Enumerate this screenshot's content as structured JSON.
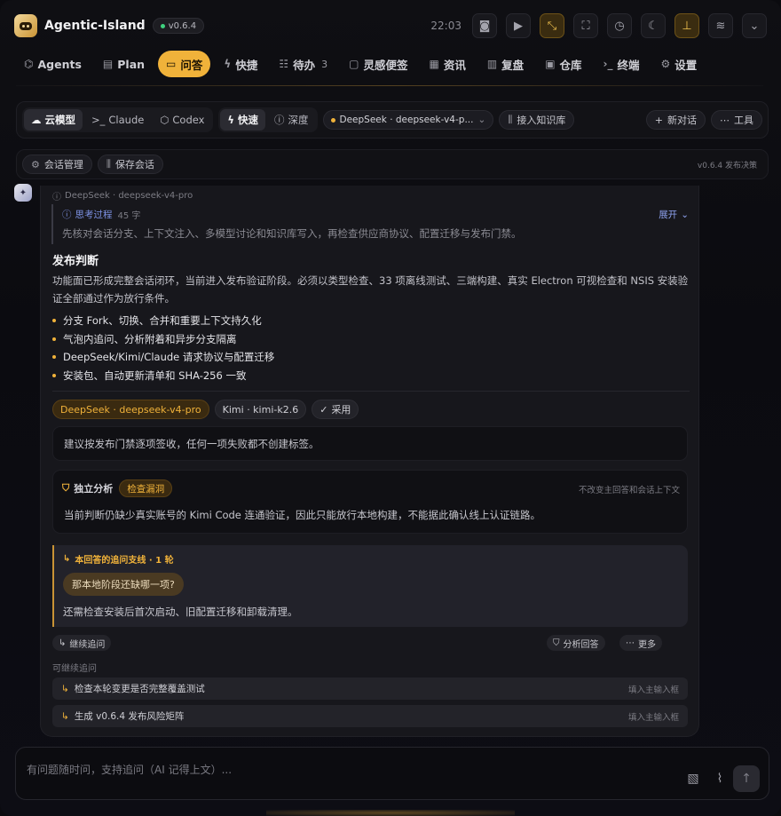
{
  "app": {
    "title": "Agentic-Island",
    "version": "v0.6.4",
    "clock": "22:03"
  },
  "nav": [
    {
      "id": "agents",
      "label": "Agents",
      "icon": "⌬"
    },
    {
      "id": "plan",
      "label": "Plan",
      "icon": "▤"
    },
    {
      "id": "qa",
      "label": "问答",
      "icon": "▭",
      "active": true
    },
    {
      "id": "quick",
      "label": "快捷",
      "icon": "ϟ"
    },
    {
      "id": "todo",
      "label": "待办",
      "icon": "☷",
      "badge": "3"
    },
    {
      "id": "notes",
      "label": "灵感便签",
      "icon": "▢"
    },
    {
      "id": "news",
      "label": "资讯",
      "icon": "▦"
    },
    {
      "id": "review",
      "label": "复盘",
      "icon": "▥"
    },
    {
      "id": "repo",
      "label": "仓库",
      "icon": "▣"
    },
    {
      "id": "terminal",
      "label": "终端",
      "icon": "›_"
    },
    {
      "id": "settings",
      "label": "设置",
      "icon": "⚙"
    }
  ],
  "toolbar": {
    "providers": [
      {
        "label": "云模型",
        "icon": "☁",
        "on": true
      },
      {
        "label": "Claude",
        "icon": ">_"
      },
      {
        "label": "Codex",
        "icon": "⬡"
      }
    ],
    "modes": [
      {
        "label": "快速",
        "icon": "ϟ",
        "on": true
      },
      {
        "label": "深度",
        "icon": "ⓘ"
      }
    ],
    "model": "DeepSeek · deepseek-v4-p...",
    "knowledge": "接入知识库",
    "new_chat": "新对话",
    "tools": "工具"
  },
  "session": {
    "manage": "会话管理",
    "save": "保存会话",
    "note": "v0.6.4 发布决策"
  },
  "message": {
    "source": "DeepSeek · deepseek-v4-pro",
    "think_title": "思考过程",
    "think_count": "45 字",
    "think_toggle": "展开",
    "think_body": "先核对会话分支、上下文注入、多模型讨论和知识库写入，再检查供应商协议、配置迁移与发布门禁。",
    "heading": "发布判断",
    "paragraph": "功能面已形成完整会话闭环，当前进入发布验证阶段。必须以类型检查、33 项离线测试、三端构建、真实 Electron 可视检查和 NSIS 安装验证全部通过作为放行条件。",
    "bullets": [
      "分支 Fork、切换、合并和重要上下文持久化",
      "气泡内追问、分析附着和异步分支隔离",
      "DeepSeek/Kimi/Claude 请求协议与配置迁移",
      "安装包、自动更新清单和 SHA-256 一致"
    ],
    "tags": {
      "model_a": "DeepSeek · deepseek-v4-pro",
      "model_b": "Kimi · kimi-k2.6",
      "adopt": "采用"
    },
    "suggestion": "建议按发布门禁逐项签收，任何一项失败都不创建标签。",
    "analysis": {
      "title": "独立分析",
      "badge": "检查漏洞",
      "note": "不改变主回答和会话上下文",
      "body": "当前判断仍缺少真实账号的 Kimi Code 连通验证，因此只能放行本地构建，不能据此确认线上认证链路。"
    },
    "thread": {
      "title": "本回答的追问支线 · 1 轮",
      "question": "那本地阶段还缺哪一项?",
      "answer": "还需检查安装后首次启动、旧配置迁移和卸载清理。"
    },
    "actions": {
      "followup": "继续追问",
      "analyze": "分析回答",
      "more": "更多"
    },
    "more_label": "可继续追问",
    "suggestions": [
      {
        "text": "检查本轮变更是否完整覆盖测试",
        "hint": "填入主输入框"
      },
      {
        "text": "生成 v0.6.4 发布风险矩阵",
        "hint": "填入主输入框"
      }
    ]
  },
  "input": {
    "placeholder": "有问题随时问，支持追问（AI 记得上文）..."
  }
}
